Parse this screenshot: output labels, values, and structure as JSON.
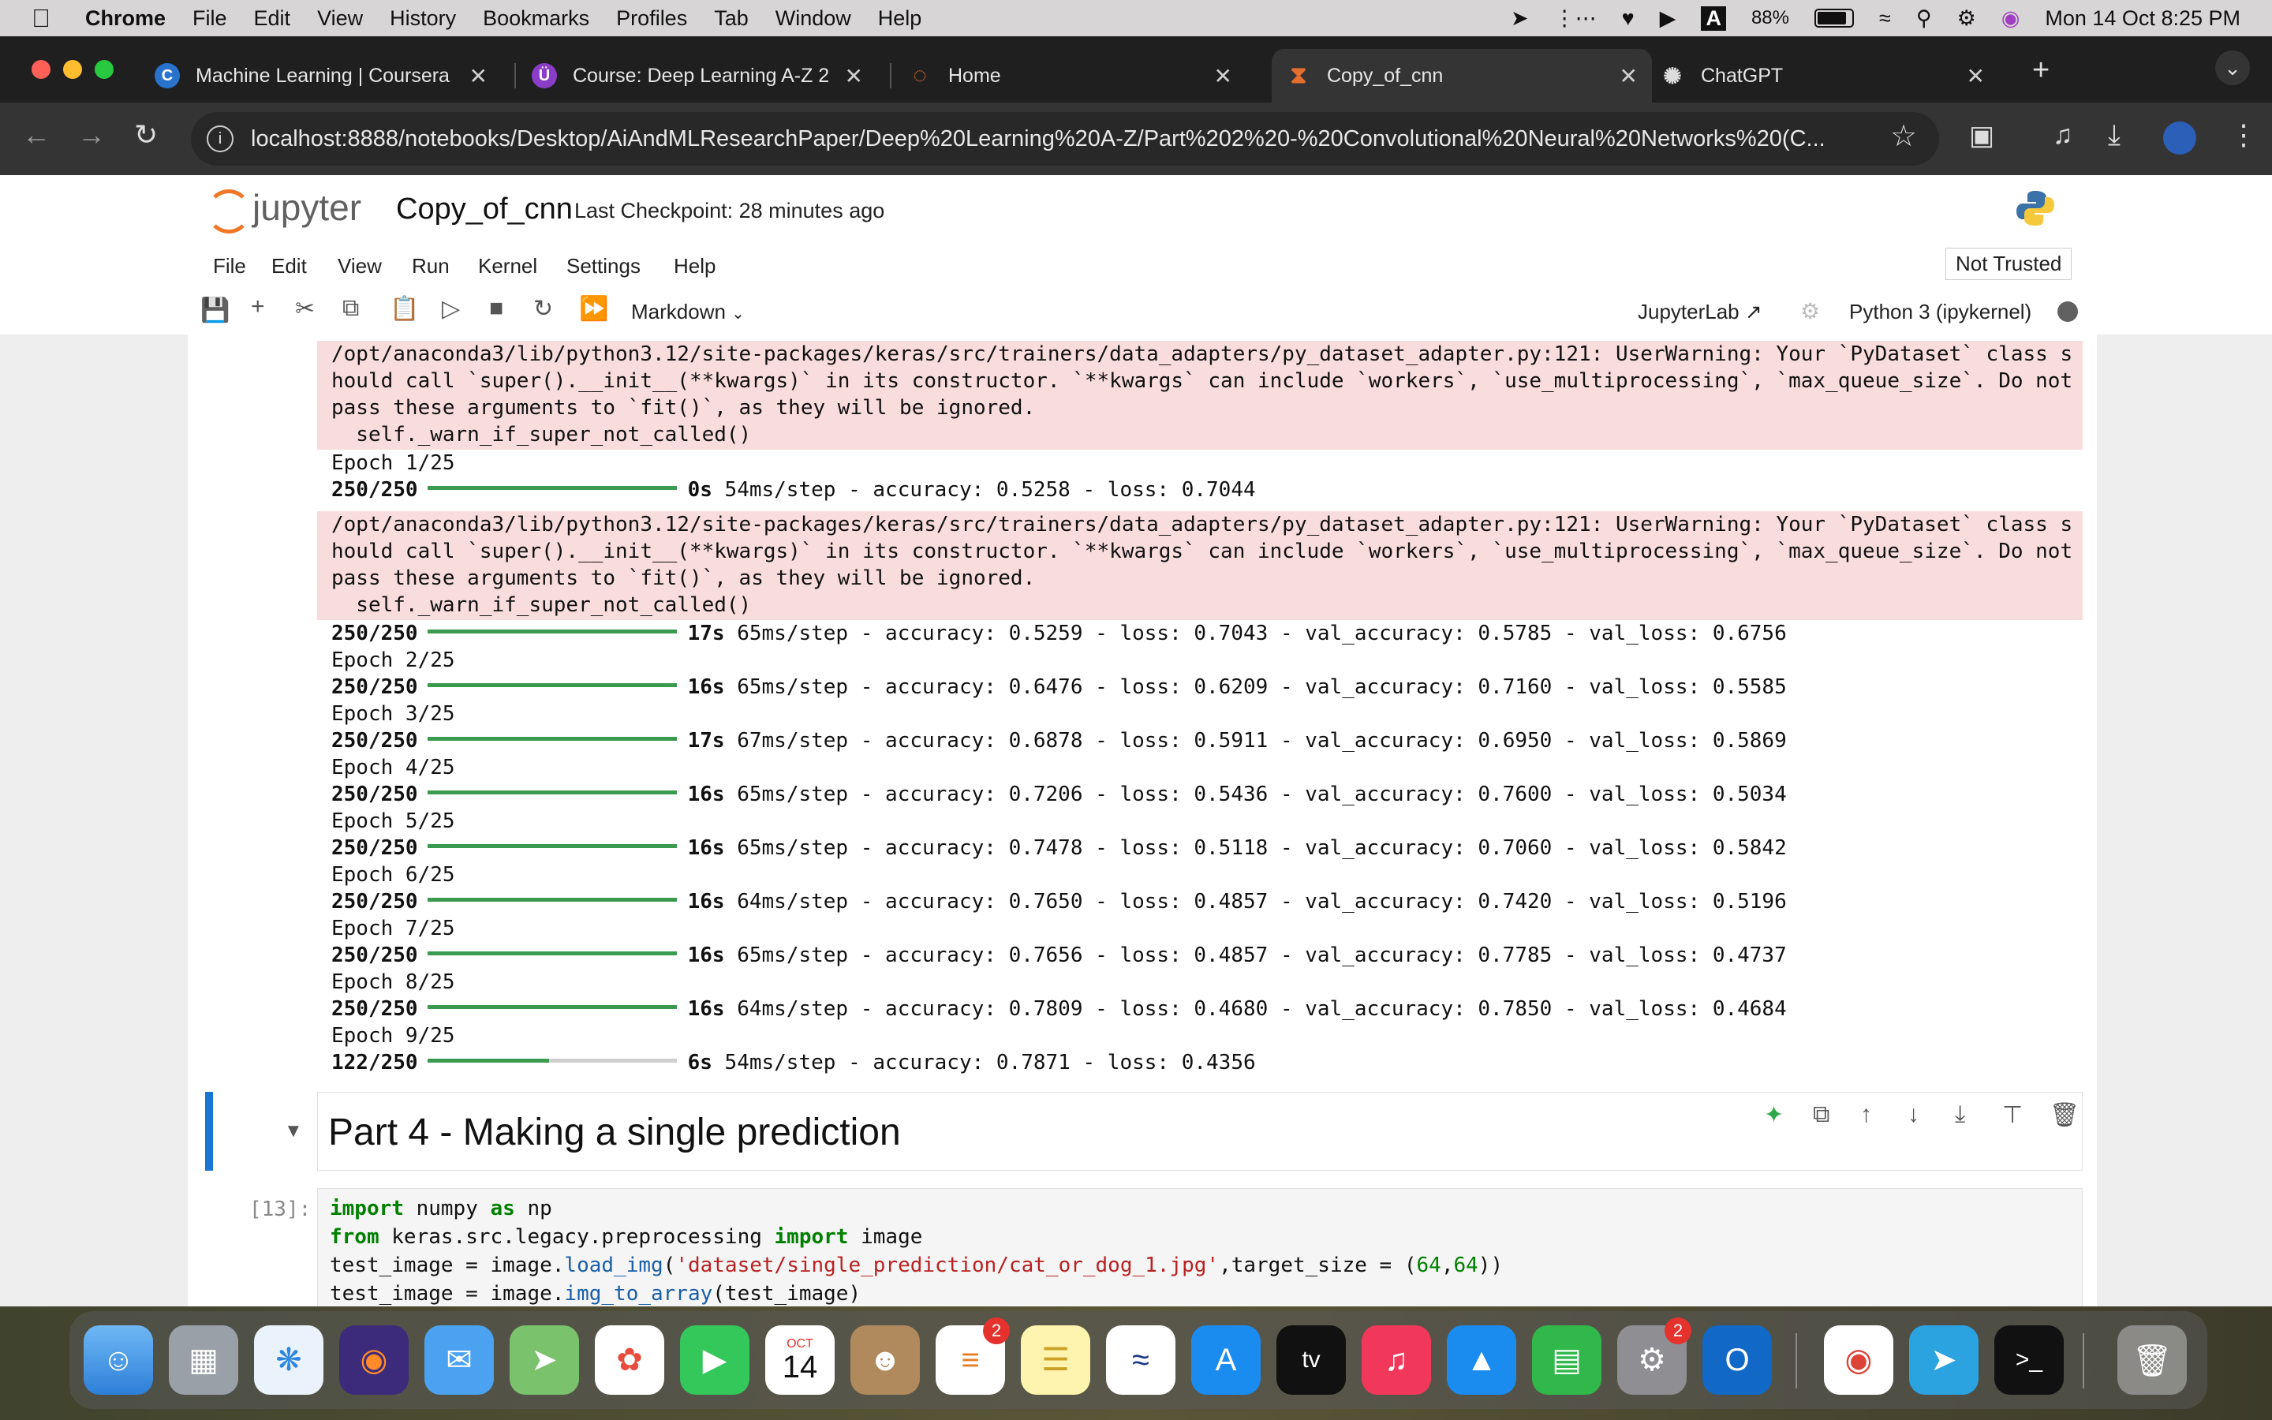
{
  "menubar": {
    "app": "Chrome",
    "items": [
      "File",
      "Edit",
      "View",
      "History",
      "Bookmarks",
      "Profiles",
      "Tab",
      "Window",
      "Help"
    ],
    "battery": "88%",
    "datetime": "Mon 14 Oct  8:25 PM"
  },
  "tabs": [
    {
      "title": "Machine Learning | Coursera",
      "icon": "coursera-icon",
      "color": "#2a73cc",
      "glyph": "C"
    },
    {
      "title": "Course: Deep Learning A-Z 2",
      "icon": "udemy-icon",
      "color": "#8a3ec8",
      "glyph": "Ü"
    },
    {
      "title": "Home",
      "icon": "jupyter-icon",
      "color": "#e46e2e",
      "glyph": "◌"
    },
    {
      "title": "Copy_of_cnn",
      "icon": "hourglass-icon",
      "color": "#e46e2e",
      "glyph": "⧗"
    },
    {
      "title": "ChatGPT",
      "icon": "chatgpt-icon",
      "color": "#444",
      "glyph": "✺"
    }
  ],
  "url": "localhost:8888/notebooks/Desktop/AiAndMLResearchPaper/Deep%20Learning%20A-Z/Part%202%20-%20Convolutional%20Neural%20Networks%20(C...",
  "jupyter": {
    "logo": "jupyter",
    "notebook_name": "Copy_of_cnn",
    "checkpoint": "Last Checkpoint: 28 minutes ago",
    "menu": [
      "File",
      "Edit",
      "View",
      "Run",
      "Kernel",
      "Settings",
      "Help"
    ],
    "trust": "Not Trusted",
    "cell_type": "Markdown",
    "jupyterlab": "JupyterLab",
    "kernel": "Python 3 (ipykernel)"
  },
  "output": {
    "warning1": "/opt/anaconda3/lib/python3.12/site-packages/keras/src/trainers/data_adapters/py_dataset_adapter.py:121: UserWarning: Your `PyDataset` class s\nhould call `super().__init__(**kwargs)` in its constructor. `**kwargs` can include `workers`, `use_multiprocessing`, `max_queue_size`. Do not\npass these arguments to `fit()`, as they will be ignored.\n  self._warn_if_super_not_called()",
    "epoch1_label": "Epoch 1/25",
    "epoch1_first": {
      "steps": "250/250",
      "time": "0s",
      "rest": " 54ms/step - accuracy: 0.5258 - loss: 0.7044",
      "progress": 1.0
    },
    "warning2": "/opt/anaconda3/lib/python3.12/site-packages/keras/src/trainers/data_adapters/py_dataset_adapter.py:121: UserWarning: Your `PyDataset` class s\nhould call `super().__init__(**kwargs)` in its constructor. `**kwargs` can include `workers`, `use_multiprocessing`, `max_queue_size`. Do not\npass these arguments to `fit()`, as they will be ignored.\n  self._warn_if_super_not_called()",
    "rows": [
      {
        "epoch": "",
        "steps": "250/250",
        "time": "17s",
        "rest": " 65ms/step - accuracy: 0.5259 - loss: 0.7043 - val_accuracy: 0.5785 - val_loss: 0.6756",
        "progress": 1.0
      },
      {
        "epoch": "Epoch 2/25",
        "steps": "250/250",
        "time": "16s",
        "rest": " 65ms/step - accuracy: 0.6476 - loss: 0.6209 - val_accuracy: 0.7160 - val_loss: 0.5585",
        "progress": 1.0
      },
      {
        "epoch": "Epoch 3/25",
        "steps": "250/250",
        "time": "17s",
        "rest": " 67ms/step - accuracy: 0.6878 - loss: 0.5911 - val_accuracy: 0.6950 - val_loss: 0.5869",
        "progress": 1.0
      },
      {
        "epoch": "Epoch 4/25",
        "steps": "250/250",
        "time": "16s",
        "rest": " 65ms/step - accuracy: 0.7206 - loss: 0.5436 - val_accuracy: 0.7600 - val_loss: 0.5034",
        "progress": 1.0
      },
      {
        "epoch": "Epoch 5/25",
        "steps": "250/250",
        "time": "16s",
        "rest": " 65ms/step - accuracy: 0.7478 - loss: 0.5118 - val_accuracy: 0.7060 - val_loss: 0.5842",
        "progress": 1.0
      },
      {
        "epoch": "Epoch 6/25",
        "steps": "250/250",
        "time": "16s",
        "rest": " 64ms/step - accuracy: 0.7650 - loss: 0.4857 - val_accuracy: 0.7420 - val_loss: 0.5196",
        "progress": 1.0
      },
      {
        "epoch": "Epoch 7/25",
        "steps": "250/250",
        "time": "16s",
        "rest": " 65ms/step - accuracy: 0.7656 - loss: 0.4857 - val_accuracy: 0.7785 - val_loss: 0.4737",
        "progress": 1.0
      },
      {
        "epoch": "Epoch 8/25",
        "steps": "250/250",
        "time": "16s",
        "rest": " 64ms/step - accuracy: 0.7809 - loss: 0.4680 - val_accuracy: 0.7850 - val_loss: 0.4684",
        "progress": 1.0
      },
      {
        "epoch": "Epoch 9/25",
        "steps": "122/250",
        "time": "6s",
        "rest": " 54ms/step - accuracy: 0.7871 - loss: 0.4356",
        "progress": 0.488
      }
    ]
  },
  "markdown_heading": "Part 4 - Making a single prediction",
  "code_cell": {
    "prompt": "[13]:",
    "line1": {
      "kw1": "import",
      "a": " numpy ",
      "kw2": "as",
      "b": " np"
    },
    "line2": {
      "kw1": "from",
      "a": " keras.src.legacy.preprocessing ",
      "kw2": "import",
      "b": " image"
    },
    "line3": {
      "a": "test_image = image.",
      "fn": "load_img",
      "b": "(",
      "str": "'dataset/single_prediction/cat_or_dog_1.jpg'",
      "c": ",target_size = (",
      "n1": "64",
      "d": ",",
      "n2": "64",
      "e": "))"
    },
    "line4": {
      "a": "test_image = image.",
      "fn": "img_to_array",
      "b": "(test_image)"
    }
  },
  "dock": {
    "calendar_month": "OCT",
    "calendar_day": "14",
    "reminders_badge": "2",
    "settings_badge": "2"
  }
}
